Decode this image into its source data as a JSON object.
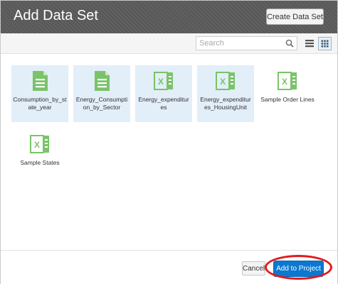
{
  "dialog": {
    "title": "Add Data Set",
    "create_button": "Create Data Set"
  },
  "toolbar": {
    "search_placeholder": "Search",
    "search_value": "",
    "view_mode": "grid"
  },
  "datasets": [
    {
      "name": "Consumption_by_state_year",
      "icon": "document-icon",
      "selected": true
    },
    {
      "name": "Energy_Consumption_by_Sector",
      "icon": "document-icon",
      "selected": true
    },
    {
      "name": "Energy_expenditures",
      "icon": "excel-icon",
      "selected": true
    },
    {
      "name": "Energy_expenditures_HousingUnit",
      "icon": "excel-icon",
      "selected": true
    },
    {
      "name": "Sample Order Lines",
      "icon": "excel-icon",
      "selected": false
    },
    {
      "name": "Sample States",
      "icon": "excel-icon",
      "selected": false
    }
  ],
  "footer": {
    "cancel": "Cancel",
    "add": "Add to Project"
  },
  "colors": {
    "header_bg": "#5b5b5b",
    "selected_tile": "#e2eef8",
    "icon_green": "#7ac36a",
    "primary_button": "#0b78d1",
    "annotation_circle": "#e21a1a"
  }
}
